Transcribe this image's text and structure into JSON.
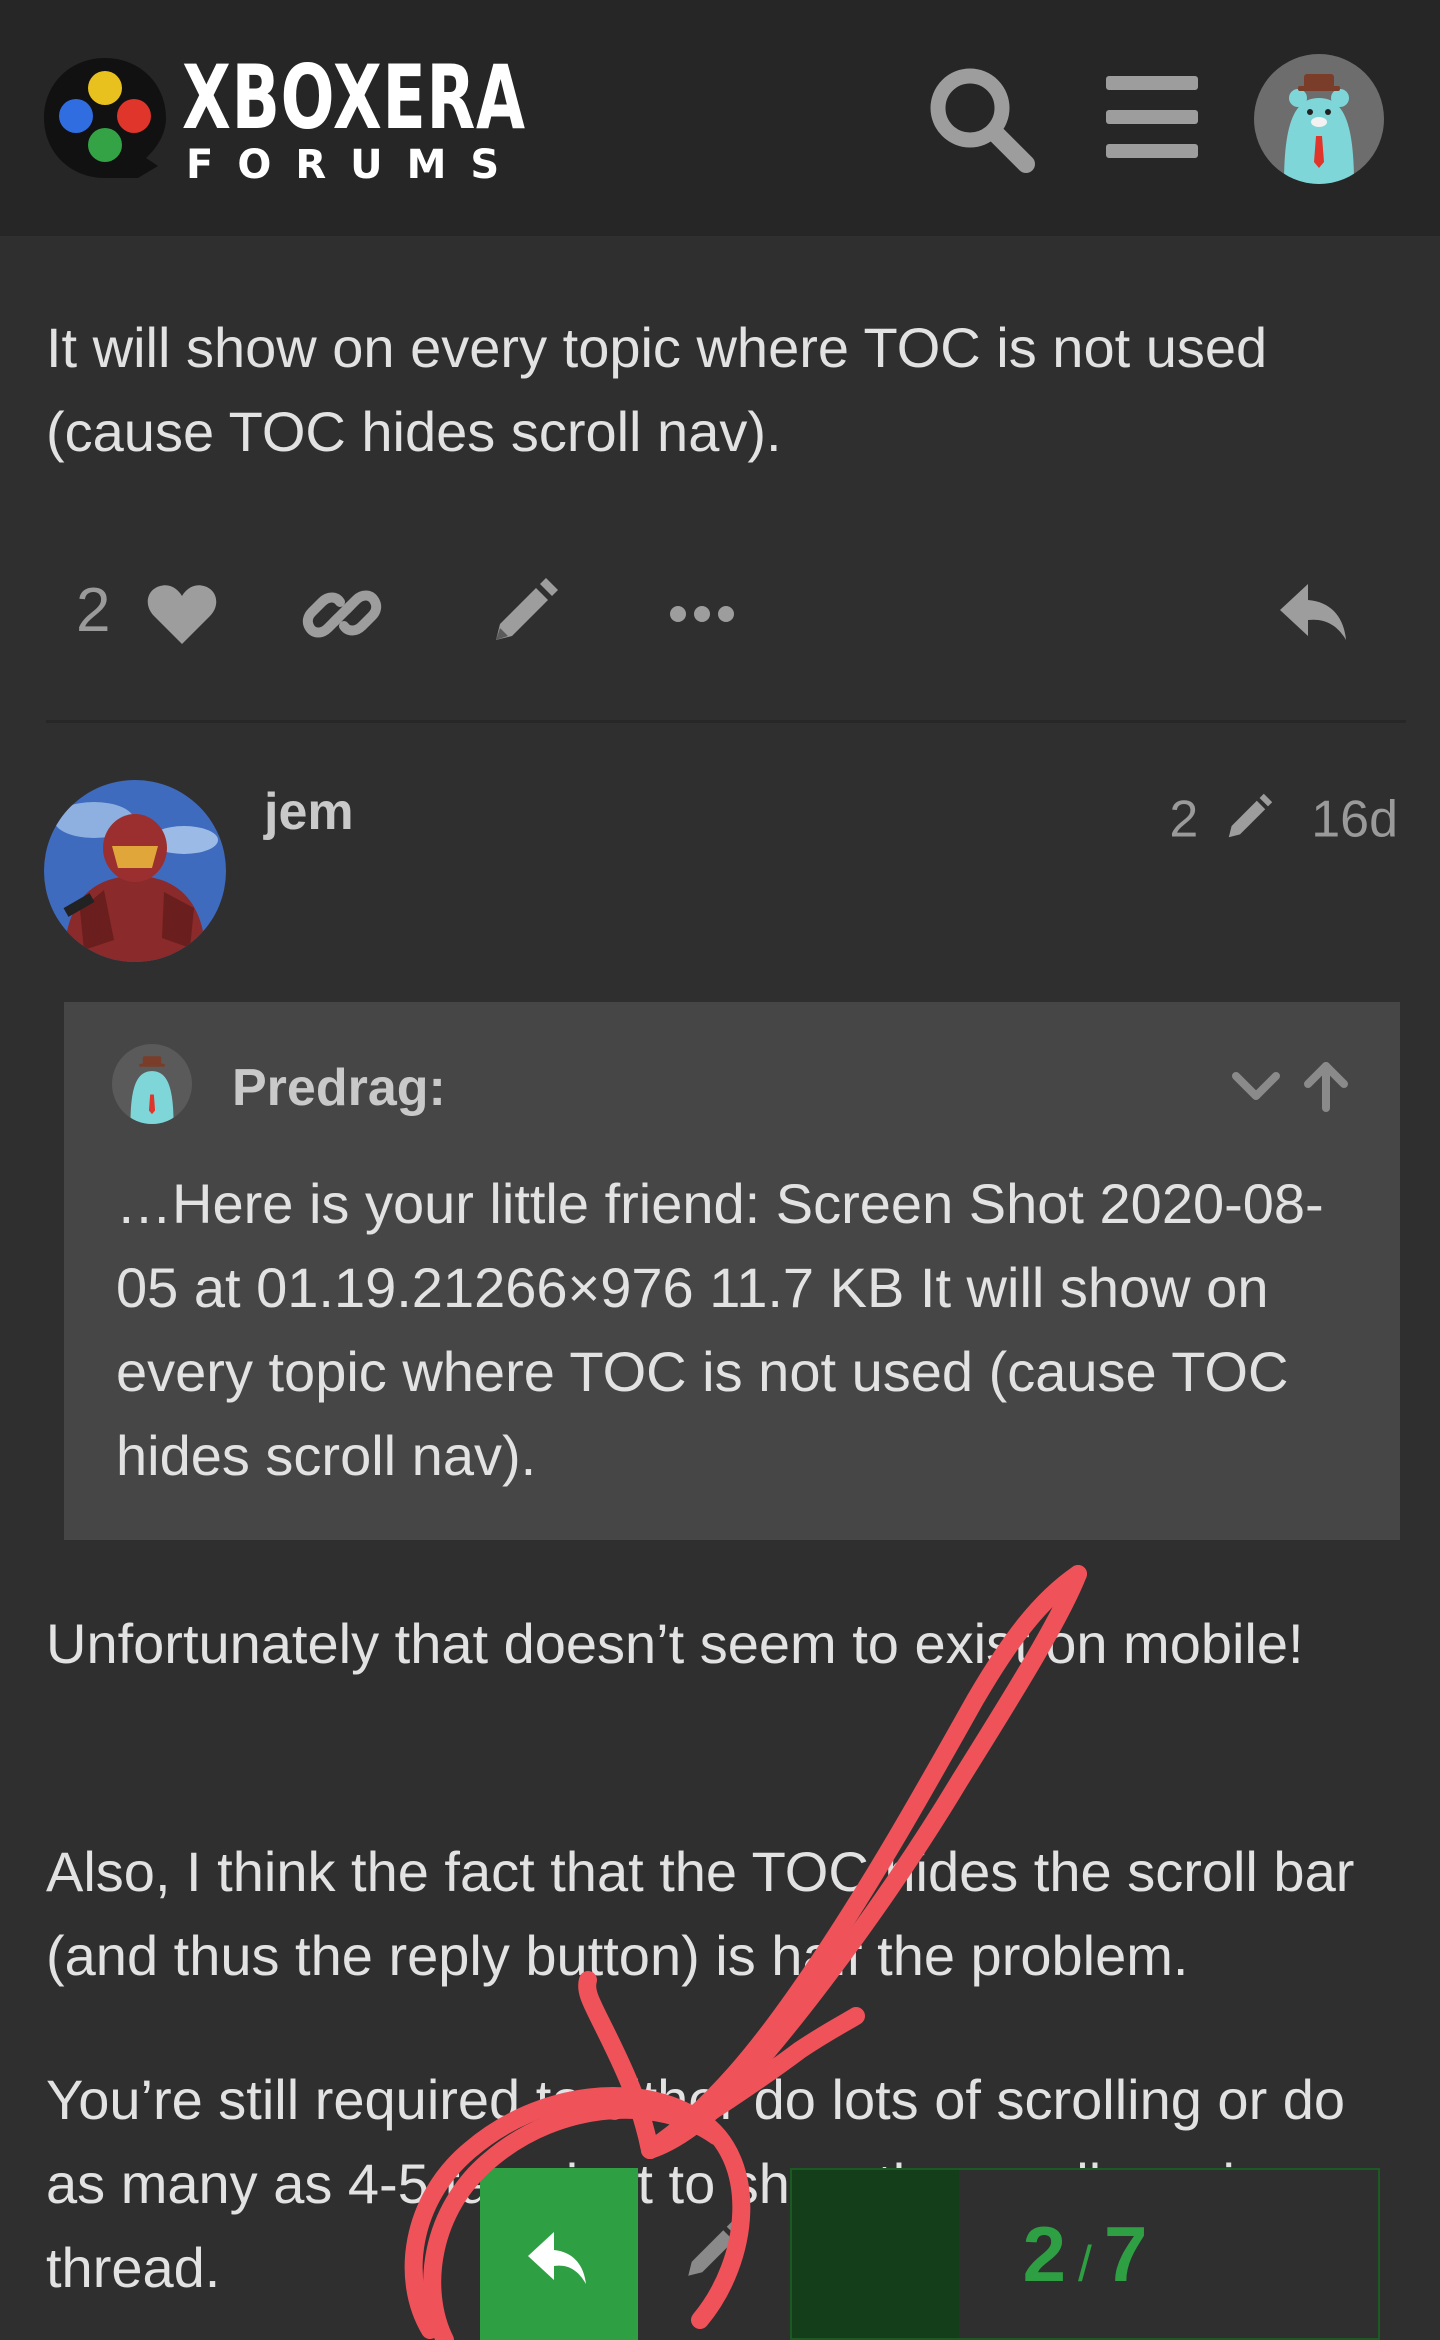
{
  "header": {
    "logo_title": "XBOXERA",
    "logo_subtitle": "FORUMS",
    "logo_colors": [
      "#e8c11f",
      "#2f6de0",
      "#e0352b",
      "#34a345"
    ],
    "search_icon": "search-icon",
    "menu_icon": "hamburger-menu-icon",
    "user_avatar_icon": "bear-avatar-icon"
  },
  "post1": {
    "text": "It will show on every topic where TOC is not used (cause TOC hides scroll nav).",
    "like_count": "2",
    "icons": [
      "heart-icon",
      "link-icon",
      "pencil-icon",
      "more-icon",
      "reply-icon"
    ]
  },
  "post2": {
    "username": "jem",
    "edit_count": "2",
    "age": "16d",
    "quote": {
      "author": "Predrag:",
      "text": "…Here is your little friend: Screen Shot 2020-08-05 at 01.19.21266×976 11.7 KB It will show on every topic where TOC is not used (cause TOC hides scroll nav)."
    },
    "paragraphs": [
      "Unfortunately that doesn’t seem to exist on mobile!",
      "Also, I think the fact that the TOC hides the scroll bar (and thus the reply button) is half the problem.",
      "You’re still required to either do lots of scrolling or do as many as 4-5 taps just to show the scroll nav in a thread."
    ]
  },
  "bottom_bar": {
    "current": "2",
    "separator": "/",
    "total": "7",
    "progress_fraction": 0.2857,
    "accent_color": "#2ea043"
  },
  "annotation": {
    "color": "#f0525a"
  }
}
